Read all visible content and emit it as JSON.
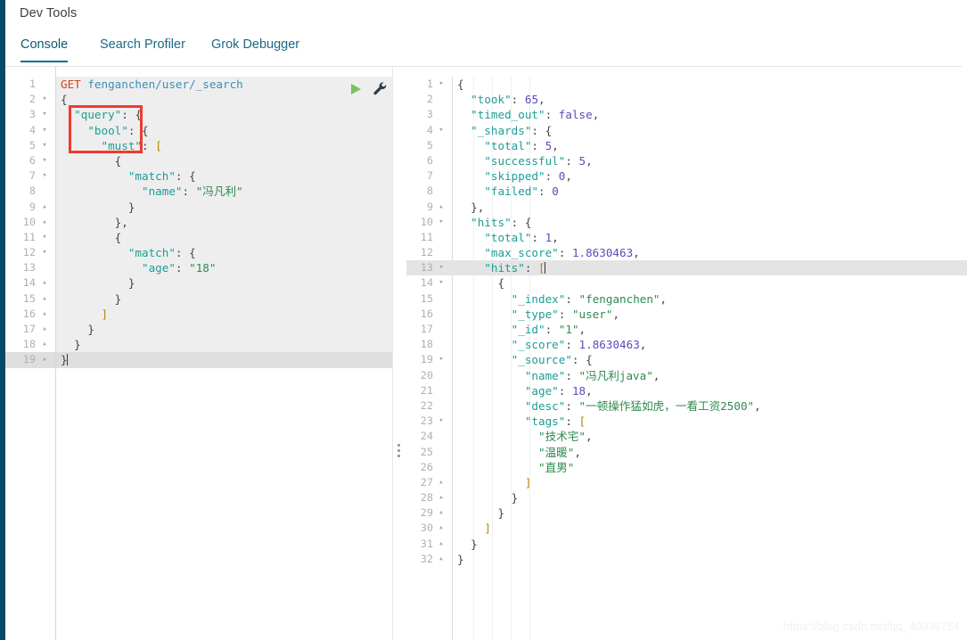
{
  "window": {
    "app_title": "Dev Tools",
    "rail_color": "#014c64",
    "accent_color": "#0d6e8c",
    "annotation_color": "#ef3b2d"
  },
  "tabs": [
    {
      "label": "Console",
      "active": true
    },
    {
      "label": "Search Profiler",
      "active": false
    },
    {
      "label": "Grok Debugger",
      "active": false
    }
  ],
  "toolbar": {
    "run_icon": "play-triangle-icon",
    "run_label": "Run request",
    "settings_icon": "wrench-icon",
    "settings_label": "Request options"
  },
  "splitter": {
    "icon": "drag-handle-dots-icon",
    "label": "Resize panels"
  },
  "request_editor": {
    "name": "console-request-editor",
    "active_line": 19,
    "cursor_line": 19,
    "lines": [
      {
        "n": 1,
        "fold": "",
        "text": "GET fenganchen/user/_search"
      },
      {
        "n": 2,
        "fold": "▾",
        "text": "{"
      },
      {
        "n": 3,
        "fold": "▾",
        "text": "  \"query\": {"
      },
      {
        "n": 4,
        "fold": "▾",
        "text": "    \"bool\": {"
      },
      {
        "n": 5,
        "fold": "▾",
        "text": "      \"must\": ["
      },
      {
        "n": 6,
        "fold": "▾",
        "text": "        {"
      },
      {
        "n": 7,
        "fold": "▾",
        "text": "          \"match\": {"
      },
      {
        "n": 8,
        "fold": "",
        "text": "            \"name\": \"冯凡利\""
      },
      {
        "n": 9,
        "fold": "▴",
        "text": "          }"
      },
      {
        "n": 10,
        "fold": "▴",
        "text": "        },"
      },
      {
        "n": 11,
        "fold": "▾",
        "text": "        {"
      },
      {
        "n": 12,
        "fold": "▾",
        "text": "          \"match\": {"
      },
      {
        "n": 13,
        "fold": "",
        "text": "            \"age\": \"18\""
      },
      {
        "n": 14,
        "fold": "▴",
        "text": "          }"
      },
      {
        "n": 15,
        "fold": "▴",
        "text": "        }"
      },
      {
        "n": 16,
        "fold": "▴",
        "text": "      ]"
      },
      {
        "n": 17,
        "fold": "▴",
        "text": "    }"
      },
      {
        "n": 18,
        "fold": "▴",
        "text": "  }"
      },
      {
        "n": 19,
        "fold": "▴",
        "text": "}"
      }
    ]
  },
  "response_editor": {
    "name": "console-response-viewer",
    "active_line": 13,
    "lines": [
      {
        "n": 1,
        "fold": "▾",
        "text": "{"
      },
      {
        "n": 2,
        "fold": "",
        "text": "  \"took\": 65,"
      },
      {
        "n": 3,
        "fold": "",
        "text": "  \"timed_out\": false,"
      },
      {
        "n": 4,
        "fold": "▾",
        "text": "  \"_shards\": {"
      },
      {
        "n": 5,
        "fold": "",
        "text": "    \"total\": 5,"
      },
      {
        "n": 6,
        "fold": "",
        "text": "    \"successful\": 5,"
      },
      {
        "n": 7,
        "fold": "",
        "text": "    \"skipped\": 0,"
      },
      {
        "n": 8,
        "fold": "",
        "text": "    \"failed\": 0"
      },
      {
        "n": 9,
        "fold": "▴",
        "text": "  },"
      },
      {
        "n": 10,
        "fold": "▾",
        "text": "  \"hits\": {"
      },
      {
        "n": 11,
        "fold": "",
        "text": "    \"total\": 1,"
      },
      {
        "n": 12,
        "fold": "",
        "text": "    \"max_score\": 1.8630463,"
      },
      {
        "n": 13,
        "fold": "▾",
        "text": "    \"hits\": ["
      },
      {
        "n": 14,
        "fold": "▾",
        "text": "      {"
      },
      {
        "n": 15,
        "fold": "",
        "text": "        \"_index\": \"fenganchen\","
      },
      {
        "n": 16,
        "fold": "",
        "text": "        \"_type\": \"user\","
      },
      {
        "n": 17,
        "fold": "",
        "text": "        \"_id\": \"1\","
      },
      {
        "n": 18,
        "fold": "",
        "text": "        \"_score\": 1.8630463,"
      },
      {
        "n": 19,
        "fold": "▾",
        "text": "        \"_source\": {"
      },
      {
        "n": 20,
        "fold": "",
        "text": "          \"name\": \"冯凡利java\","
      },
      {
        "n": 21,
        "fold": "",
        "text": "          \"age\": 18,"
      },
      {
        "n": 22,
        "fold": "",
        "text": "          \"desc\": \"一顿操作猛如虎，一看工资2500\","
      },
      {
        "n": 23,
        "fold": "▾",
        "text": "          \"tags\": ["
      },
      {
        "n": 24,
        "fold": "",
        "text": "            \"技术宅\","
      },
      {
        "n": 25,
        "fold": "",
        "text": "            \"温暖\","
      },
      {
        "n": 26,
        "fold": "",
        "text": "            \"直男\""
      },
      {
        "n": 27,
        "fold": "▴",
        "text": "          ]"
      },
      {
        "n": 28,
        "fold": "▴",
        "text": "        }"
      },
      {
        "n": 29,
        "fold": "▴",
        "text": "      }"
      },
      {
        "n": 30,
        "fold": "▴",
        "text": "    ]"
      },
      {
        "n": 31,
        "fold": "▴",
        "text": "  }"
      },
      {
        "n": 32,
        "fold": "▴",
        "text": "}"
      }
    ]
  },
  "annotation": {
    "name": "red-highlight-box",
    "covers": "\"query\" / \"bool\" / \"must\""
  },
  "watermark": {
    "text": "https://blog.csdn.net/qq_40036754"
  }
}
